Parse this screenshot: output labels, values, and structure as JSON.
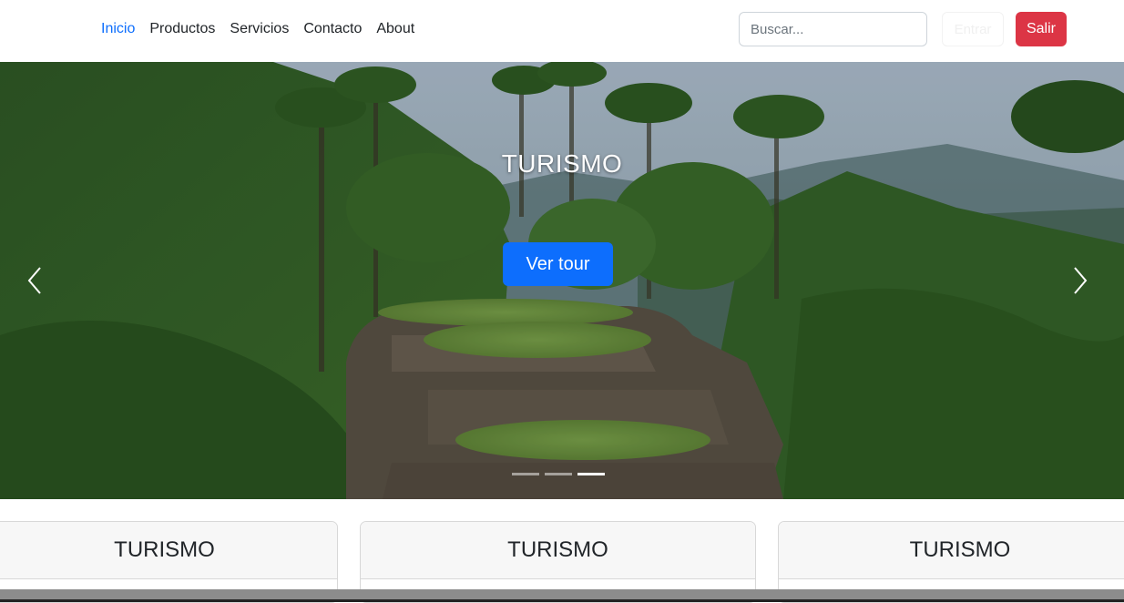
{
  "nav": {
    "links": [
      "Inicio",
      "Productos",
      "Servicios",
      "Contacto",
      "About"
    ],
    "active": "Inicio",
    "search_placeholder": "Buscar...",
    "enter_label": "Entrar",
    "exit_label": "Salir"
  },
  "hero": {
    "caption": "TURISMO",
    "button_label": "Ver tour",
    "indicators_count": 3,
    "active_indicator": 3
  },
  "cards": [
    {
      "title": "TURISMO"
    },
    {
      "title": "TURISMO"
    },
    {
      "title": "TURISMO"
    }
  ],
  "colors": {
    "primary": "#0d6efd",
    "danger": "#dc3545"
  }
}
